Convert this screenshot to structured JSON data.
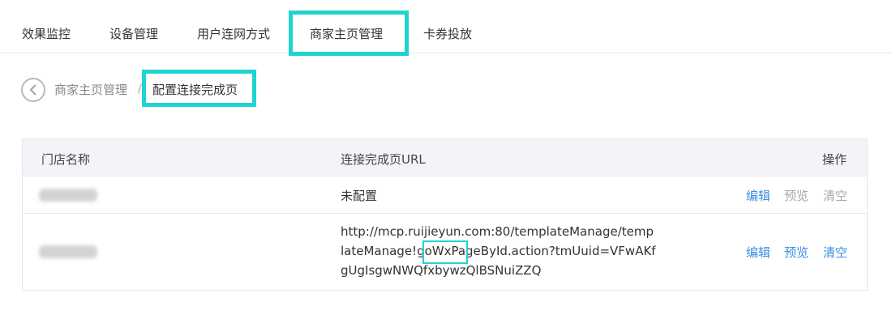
{
  "tabs": [
    {
      "label": "效果监控"
    },
    {
      "label": "设备管理"
    },
    {
      "label": "用户连网方式"
    },
    {
      "label": "商家主页管理",
      "active": true
    },
    {
      "label": "卡券投放"
    }
  ],
  "breadcrumb": {
    "parent": "商家主页管理",
    "separator": "/",
    "current": "配置连接完成页"
  },
  "table": {
    "columns": [
      "门店名称",
      "连接完成页URL",
      "操作"
    ],
    "rows": [
      {
        "store_name": "",
        "url": "未配置",
        "actions": {
          "edit": "编辑",
          "preview": "预览",
          "clear": "清空"
        },
        "preview_enabled": false
      },
      {
        "store_name": "",
        "url": "http://mcp.ruijieyun.com:80/templateManage/templateManage!goWxPageById.action?tmUuid=VFwAKfgUgIsgwNWQfxbywzQlBSNuiZZQ",
        "actions": {
          "edit": "编辑",
          "preview": "预览",
          "clear": "清空"
        },
        "preview_enabled": true
      }
    ]
  },
  "colors": {
    "highlight": "#1fd4d0",
    "link": "#3a8ee6",
    "disabled": "#aaaaaa",
    "header_bg": "#f3f4f7"
  }
}
